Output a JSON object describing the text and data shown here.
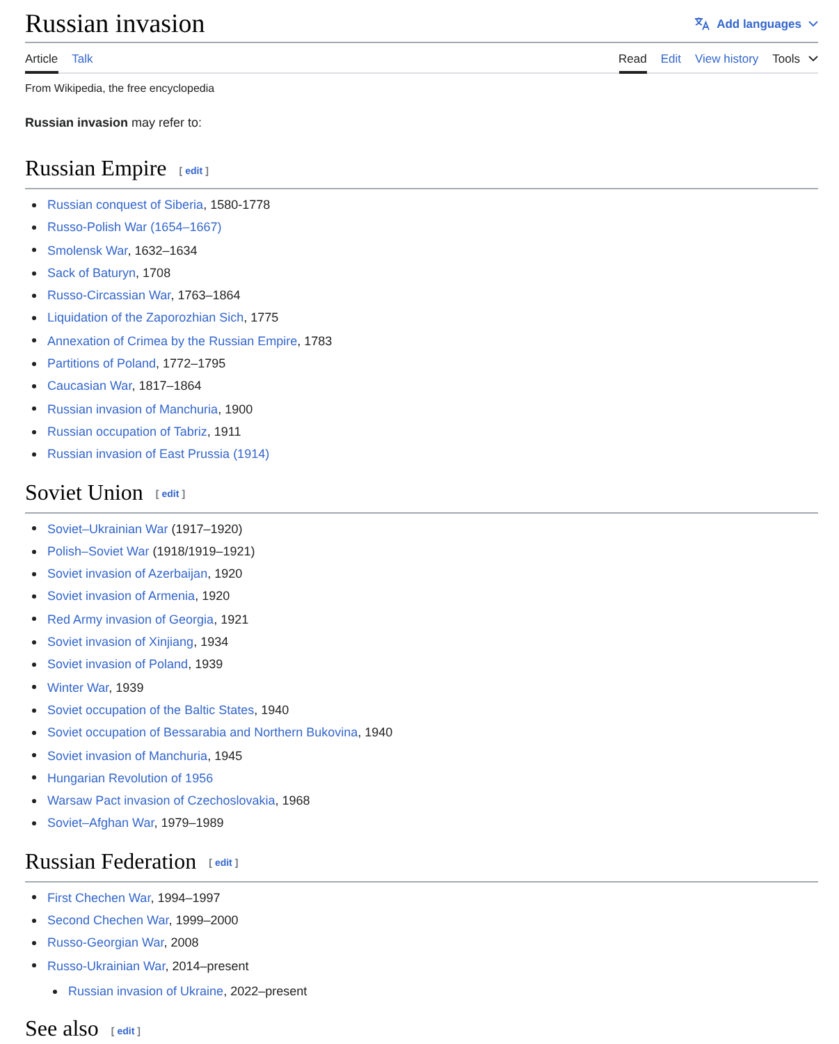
{
  "page": {
    "title": "Russian invasion",
    "add_languages": "Add languages"
  },
  "tabs_left": [
    {
      "label": "Article",
      "selected": true,
      "kind": "tab"
    },
    {
      "label": "Talk",
      "selected": false,
      "kind": "tab"
    }
  ],
  "tabs_right": [
    {
      "label": "Read",
      "selected": true,
      "kind": "tab"
    },
    {
      "label": "Edit",
      "selected": false,
      "kind": "tab"
    },
    {
      "label": "View history",
      "selected": false,
      "kind": "tab"
    },
    {
      "label": "Tools",
      "selected": false,
      "kind": "menu"
    }
  ],
  "tagline": "From Wikipedia, the free encyclopedia",
  "intro": "**Russian invasion** may refer to:",
  "sections": [
    {
      "heading": "Russian Empire",
      "edit": {
        "open": "[",
        "label": "edit",
        "close": "]"
      },
      "items": [
        {
          "link": "Russian conquest of Siberia",
          "suffix": ", 1580-1778"
        },
        {
          "link": "Russo-Polish War (1654–1667)"
        },
        {
          "link": "Smolensk War",
          "suffix": ", 1632–1634"
        },
        {
          "link": "Sack of Baturyn",
          "suffix": ", 1708"
        },
        {
          "link": "Russo-Circassian War",
          "suffix": ", 1763–1864"
        },
        {
          "link": "Liquidation of the Zaporozhian Sich",
          "suffix": ", 1775"
        },
        {
          "link": "Annexation of Crimea by the Russian Empire",
          "suffix": ", 1783"
        },
        {
          "link": "Partitions of Poland",
          "suffix": ", 1772–1795"
        },
        {
          "link": "Caucasian War",
          "suffix": ", 1817–1864"
        },
        {
          "link": "Russian invasion of Manchuria",
          "suffix": ", 1900"
        },
        {
          "link": "Russian occupation of Tabriz",
          "suffix": ", 1911"
        },
        {
          "link": "Russian invasion of East Prussia (1914)"
        }
      ]
    },
    {
      "heading": "Soviet Union",
      "edit": {
        "open": "[",
        "label": "edit",
        "close": "]"
      },
      "items": [
        {
          "link": "Soviet–Ukrainian War",
          "suffix": " (1917–1920)"
        },
        {
          "link": "Polish–Soviet War",
          "suffix": " (1918/1919–1921)"
        },
        {
          "link": "Soviet invasion of Azerbaijan",
          "suffix": ", 1920"
        },
        {
          "link": "Soviet invasion of Armenia",
          "suffix": ", 1920"
        },
        {
          "link": "Red Army invasion of Georgia",
          "suffix": ", 1921"
        },
        {
          "link": "Soviet invasion of Xinjiang",
          "suffix": ", 1934"
        },
        {
          "link": "Soviet invasion of Poland",
          "suffix": ", 1939"
        },
        {
          "link": "Winter War",
          "suffix": ", 1939"
        },
        {
          "link": "Soviet occupation of the Baltic States",
          "suffix": ", 1940"
        },
        {
          "link": "Soviet occupation of Bessarabia and Northern Bukovina",
          "suffix": ", 1940"
        },
        {
          "link": "Soviet invasion of Manchuria",
          "suffix": ", 1945"
        },
        {
          "link": "Hungarian Revolution of 1956"
        },
        {
          "link": "Warsaw Pact invasion of Czechoslovakia",
          "suffix": ", 1968"
        },
        {
          "link": "Soviet–Afghan War",
          "suffix": ", 1979–1989"
        }
      ]
    },
    {
      "heading": "Russian Federation",
      "edit": {
        "open": "[",
        "label": "edit",
        "close": "]"
      },
      "items": [
        {
          "link": "First Chechen War",
          "suffix": ", 1994–1997"
        },
        {
          "link": "Second Chechen War",
          "suffix": ", 1999–2000"
        },
        {
          "link": "Russo-Georgian War",
          "suffix": ", 2008"
        },
        {
          "link": "Russo-Ukrainian War",
          "suffix": ", 2014–present",
          "children": [
            {
              "link": "Russian invasion of Ukraine",
              "suffix": ", 2022–present"
            }
          ]
        }
      ]
    },
    {
      "heading": "See also",
      "edit": {
        "open": "[",
        "label": "edit",
        "close": "]"
      }
    }
  ]
}
